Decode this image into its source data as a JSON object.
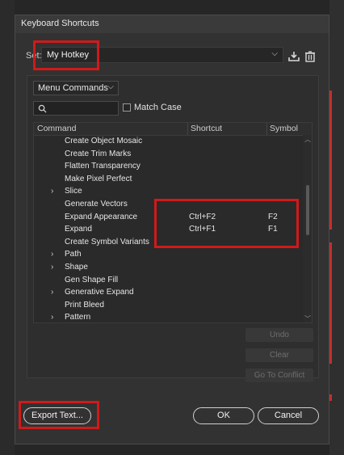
{
  "window": {
    "title": "Keyboard Shortcuts"
  },
  "set": {
    "label": "Set:",
    "value": "My Hotkey",
    "save_icon": "save-set-icon",
    "delete_icon": "trash-icon"
  },
  "filter": {
    "dropdown_value": "Menu Commands",
    "search_placeholder": "",
    "match_case_label": "Match Case",
    "match_case_checked": false
  },
  "table": {
    "headers": {
      "command": "Command",
      "shortcut": "Shortcut",
      "symbol": "Symbol"
    },
    "rows": [
      {
        "expandable": false,
        "command": "Create Object Mosaic",
        "shortcut": "",
        "symbol": ""
      },
      {
        "expandable": false,
        "command": "Create Trim Marks",
        "shortcut": "",
        "symbol": ""
      },
      {
        "expandable": false,
        "command": "Flatten Transparency",
        "shortcut": "",
        "symbol": ""
      },
      {
        "expandable": false,
        "command": "Make Pixel Perfect",
        "shortcut": "",
        "symbol": ""
      },
      {
        "expandable": true,
        "arrow": "›",
        "command": "Slice",
        "shortcut": "",
        "symbol": ""
      },
      {
        "expandable": false,
        "command": "Generate Vectors",
        "shortcut": "",
        "symbol": ""
      },
      {
        "expandable": false,
        "command": "Expand Appearance",
        "shortcut": "Ctrl+F2",
        "symbol": "F2"
      },
      {
        "expandable": false,
        "command": "Expand",
        "shortcut": "Ctrl+F1",
        "symbol": "F1"
      },
      {
        "expandable": false,
        "command": "Create Symbol Variants",
        "shortcut": "",
        "symbol": ""
      },
      {
        "expandable": true,
        "arrow": "›",
        "command": "Path",
        "shortcut": "",
        "symbol": ""
      },
      {
        "expandable": true,
        "arrow": "›",
        "command": "Shape",
        "shortcut": "",
        "symbol": ""
      },
      {
        "expandable": false,
        "command": "Gen Shape Fill",
        "shortcut": "",
        "symbol": ""
      },
      {
        "expandable": true,
        "arrow": "›",
        "command": "Generative Expand",
        "shortcut": "",
        "symbol": ""
      },
      {
        "expandable": false,
        "command": "Print Bleed",
        "shortcut": "",
        "symbol": ""
      },
      {
        "expandable": true,
        "arrow": "›",
        "command": "Pattern",
        "shortcut": "",
        "symbol": ""
      }
    ]
  },
  "side_buttons": {
    "undo": "Undo",
    "clear": "Clear",
    "go_to_conflict": "Go To Conflict"
  },
  "footer": {
    "export": "Export Text...",
    "ok": "OK",
    "cancel": "Cancel"
  },
  "colors": {
    "highlight": "#d01a1a",
    "dialog_bg": "#323232",
    "accent_stripe": "#c0302f"
  }
}
